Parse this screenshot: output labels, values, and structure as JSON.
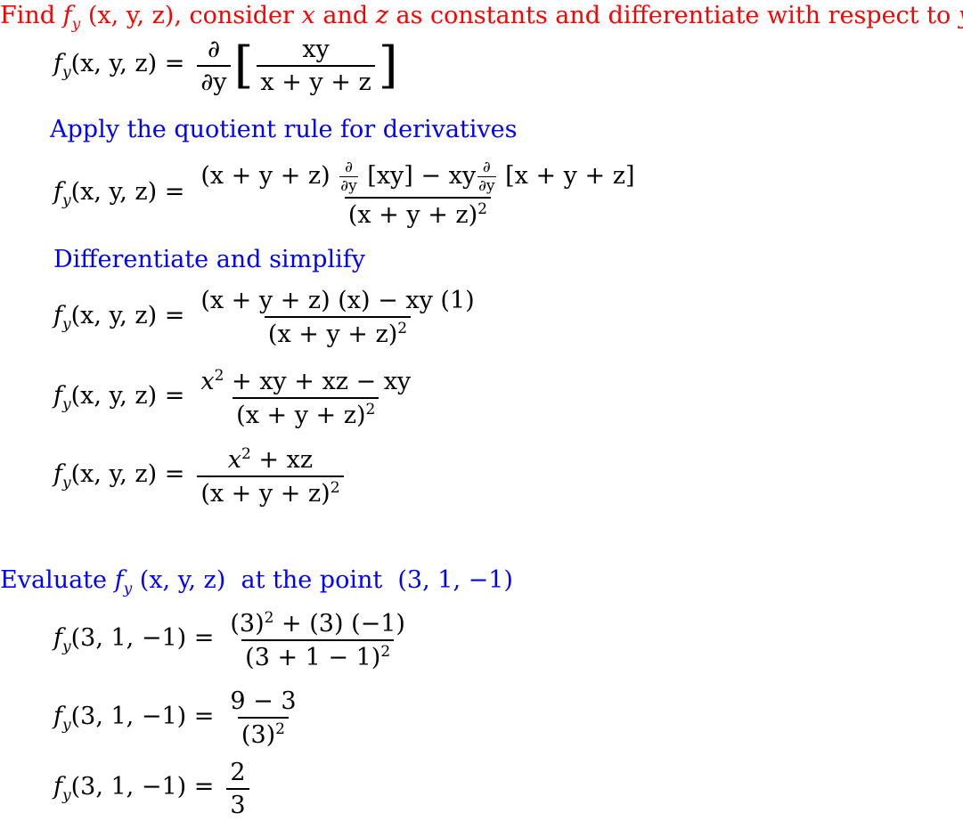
{
  "step1": {
    "heading_prefix": "Find ",
    "heading_func": "f",
    "heading_sub": "y",
    "heading_args": " (x, y, z), ",
    "heading_mid1": "consider ",
    "heading_x": "x",
    "heading_mid2": " and ",
    "heading_z": "z",
    "heading_suffix": " as constants and differentiate with respect to ",
    "heading_y": "y",
    "color": "#ff0000"
  },
  "lhs_label": "(x, y, z) =",
  "eq1": {
    "num": "∂",
    "den": "∂y",
    "inner_num": "xy",
    "inner_den": "x + y + z"
  },
  "note1": "Apply the quotient rule for derivatives",
  "eq2": {
    "num_a": "(x + y + z)",
    "d_num": "∂",
    "d_den": "∂y",
    "num_b": "[xy] − xy",
    "num_c": "[x + y + z]",
    "den": "(x + y + z)",
    "den_exp": "2"
  },
  "note2": "Differentiate and simplify",
  "eq3": {
    "num": "(x + y + z) (x) − xy (1)",
    "den": "(x + y + z)",
    "den_exp": "2"
  },
  "eq4": {
    "num_a": "x",
    "num_exp": "2",
    "num_b": " + xy + xz − xy",
    "den": "(x + y + z)",
    "den_exp": "2"
  },
  "eq5": {
    "num_a": "x",
    "num_exp": "2",
    "num_b": " + xz",
    "den": "(x + y + z)",
    "den_exp": "2"
  },
  "step2": {
    "prefix": "Evaluate ",
    "func": "f",
    "sub": "y",
    "args": " (x, y, z)",
    "mid": "  at the point  ",
    "point": "(3, 1, −1)",
    "color": "#0000ff"
  },
  "lhs_point": "(3, 1, −1) =",
  "eq6": {
    "num_a": "(3)",
    "num_exp": "2",
    "num_b": " + (3) (−1)",
    "den": "(3 + 1 − 1)",
    "den_exp": "2"
  },
  "eq7": {
    "num": "9 − 3",
    "den": "(3)",
    "den_exp": "2"
  },
  "eq8": {
    "num": "2",
    "den": "3"
  },
  "func_name": "f",
  "func_sub": "y"
}
